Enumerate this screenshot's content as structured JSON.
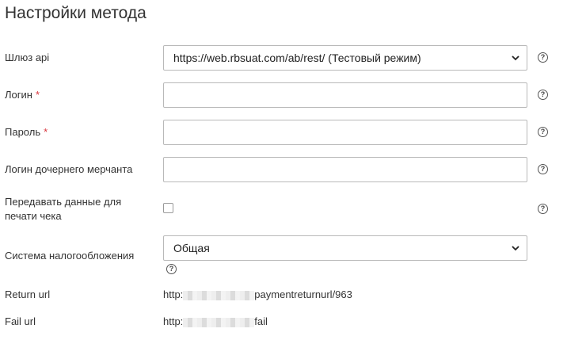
{
  "page": {
    "title": "Настройки метода"
  },
  "form": {
    "gateway": {
      "label": "Шлюз api",
      "value": "https://web.rbsuat.com/ab/rest/ (Тестовый режим)"
    },
    "login": {
      "label": "Логин",
      "required_mark": "*",
      "value": ""
    },
    "password": {
      "label": "Пароль",
      "required_mark": "*",
      "value": ""
    },
    "child_login": {
      "label": "Логин дочернего мерчанта",
      "value": ""
    },
    "receipt": {
      "label_line1": "Передавать данные для",
      "label_line2": "печати чека",
      "checked": false
    },
    "tax": {
      "label": "Система налогообложения",
      "value": "Общая"
    },
    "return_url": {
      "label": "Return url",
      "prefix": "http:",
      "suffix": "paymentreturnurl/963"
    },
    "fail_url": {
      "label": "Fail url",
      "prefix": "http:",
      "suffix": "fail"
    }
  },
  "icons": {
    "help": "?",
    "help_name": "question-circle-icon",
    "chevron": "chevron-down-icon"
  },
  "colors": {
    "required": "#d9363e",
    "border": "#b9b9b9",
    "text": "#333333"
  }
}
